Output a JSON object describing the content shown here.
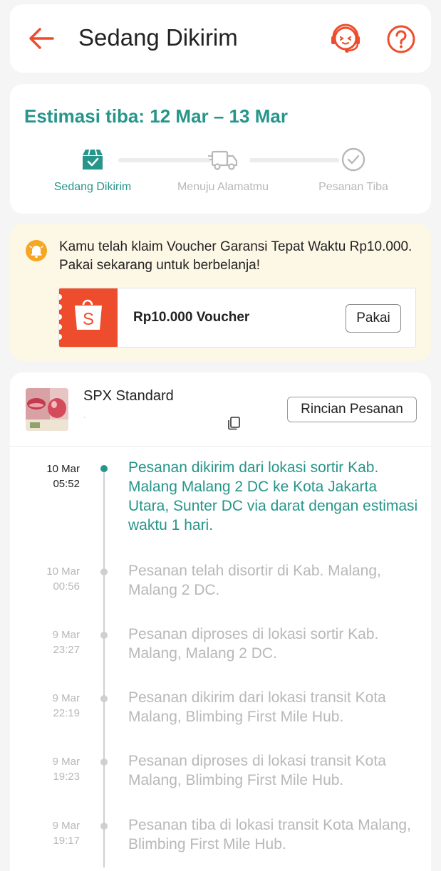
{
  "header": {
    "title": "Sedang Dikirim"
  },
  "estimate": {
    "title": "Estimasi tiba: 12 Mar – 13 Mar",
    "steps": [
      {
        "label": "Sedang Dikirim",
        "icon": "package-icon",
        "active": true
      },
      {
        "label": "Menuju Alamatmu",
        "icon": "truck-icon",
        "active": false
      },
      {
        "label": "Pesanan Tiba",
        "icon": "check-circle-icon",
        "active": false
      }
    ]
  },
  "voucher": {
    "message": "Kamu telah klaim Voucher Garansi Tepat Waktu Rp10.000. Pakai sekarang untuk berbelanja!",
    "label": "Rp10.000 Voucher",
    "button": "Pakai",
    "logo_text": "S"
  },
  "shipment": {
    "carrier": "SPX Standard",
    "tracking_number": "` ",
    "detail_button": "Rincian Pesanan"
  },
  "events": [
    {
      "date": "10 Mar",
      "time": "05:52",
      "text": "Pesanan dikirim dari lokasi sortir Kab. Malang  Malang 2 DC ke Kota Jakarta Utara, Sunter DC via darat dengan estimasi waktu 1 hari.",
      "active": true
    },
    {
      "date": "10 Mar",
      "time": "00:56",
      "text": "Pesanan telah disortir di Kab. Malang, Malang 2 DC.",
      "active": false
    },
    {
      "date": "9 Mar",
      "time": "23:27",
      "text": "Pesanan diproses di lokasi sortir Kab. Malang, Malang 2 DC.",
      "active": false
    },
    {
      "date": "9 Mar",
      "time": "22:19",
      "text": "Pesanan dikirim dari lokasi transit Kota Malang, Blimbing First Mile Hub.",
      "active": false
    },
    {
      "date": "9 Mar",
      "time": "19:23",
      "text": "Pesanan diproses di lokasi transit Kota Malang, Blimbing First Mile Hub.",
      "active": false
    },
    {
      "date": "9 Mar",
      "time": "19:17",
      "text": "Pesanan tiba di lokasi transit Kota Malang, Blimbing First Mile Hub.",
      "active": false
    }
  ],
  "colors": {
    "brand_orange": "#ee4d2d",
    "teal": "#26958a",
    "muted_gray": "#b8b8b8",
    "voucher_bg": "#fdf7e6"
  }
}
